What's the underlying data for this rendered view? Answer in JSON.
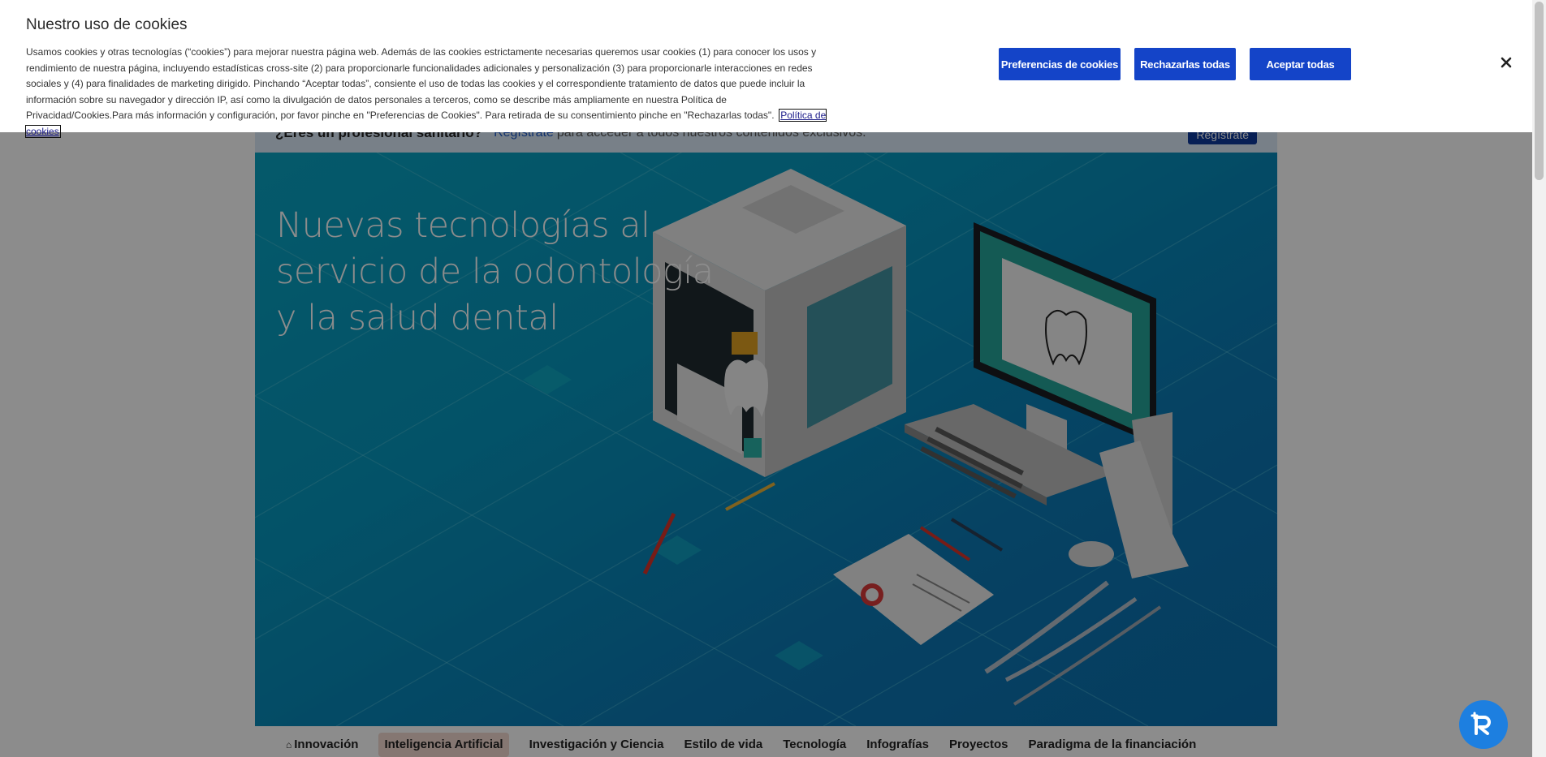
{
  "professional_bar": {
    "question": "¿Eres un profesional sanitario?",
    "register_link": "Regístrate",
    "rest_text": "para acceder a todos nuestros contenidos exclusivos.",
    "register_button": "Regístrate"
  },
  "hero": {
    "title": "Nuevas tecnologías al servicio de la odontología y la salud dental"
  },
  "tabs": [
    {
      "label": "Innovación"
    },
    {
      "label": "Inteligencia Artificial"
    },
    {
      "label": "Investigación y Ciencia"
    },
    {
      "label": "Estilo de vida"
    },
    {
      "label": "Tecnología"
    },
    {
      "label": "Infografías"
    },
    {
      "label": "Proyectos"
    },
    {
      "label": "Paradigma de la financiación"
    }
  ],
  "cookie_banner": {
    "title": "Nuestro uso de cookies",
    "text": "Usamos cookies y otras tecnologías (“cookies”) para mejorar nuestra página web. Además de las cookies estrictamente necesarias queremos usar cookies (1) para conocer los usos y rendimiento de nuestra página, incluyendo estadísticas cross-site (2) para proporcionarle funcionalidades adicionales y personalización (3) para proporcionarle interacciones en redes sociales y (4) para finalidades de marketing dirigido. Pinchando “Aceptar todas”, consiente el uso de todas las cookies y el correspondiente tratamiento de datos que puede incluir la información sobre su navegador y dirección IP, así como la divulgación de datos personales a terceros, como se describe más ampliamente en nuestra Política de Privacidad/Cookies.Para más información y configuración, por favor pinche en \"Preferencias de Cookies\". Para retirada de su consentimiento pinche en \"Rechazarlas todas\".",
    "policy_link": "Política de cookies",
    "preferences_button": "Preferencias de cookies",
    "reject_button": "Rechazarlas todas",
    "accept_button": "Aceptar todas"
  },
  "colors": {
    "primary_button": "#1444c8",
    "hero_bg": "#0796bd",
    "fab": "#1d7fe0"
  }
}
